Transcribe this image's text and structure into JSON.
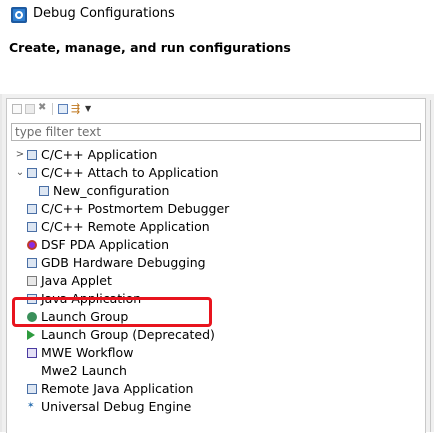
{
  "window": {
    "title": "Debug Configurations"
  },
  "header": {
    "title": "Create, manage, and run configurations"
  },
  "filter": {
    "placeholder": "type filter text"
  },
  "toolbar": {
    "icons": [
      "new-configuration-icon",
      "duplicate-icon",
      "delete-icon",
      "collapse-all-icon",
      "filter-icon",
      "dropdown-arrow-icon"
    ]
  },
  "tree": {
    "items": [
      {
        "label": "C/C++ Application",
        "expand": ">",
        "icon": "c-app-icon"
      },
      {
        "label": "C/C++ Attach to Application",
        "expand": "⌄",
        "icon": "c-attach-icon"
      },
      {
        "label": "New_configuration",
        "icon": "c-config-icon"
      },
      {
        "label": "C/C++ Postmortem Debugger",
        "icon": "c-postmortem-icon"
      },
      {
        "label": "C/C++ Remote Application",
        "icon": "c-remote-icon"
      },
      {
        "label": "DSF PDA Application",
        "icon": "dsf-pda-icon"
      },
      {
        "label": "GDB Hardware Debugging",
        "icon": "gdb-hardware-icon"
      },
      {
        "label": "Java Applet",
        "icon": "java-applet-icon"
      },
      {
        "label": "Java Application",
        "icon": "java-app-icon"
      },
      {
        "label": "Launch Group",
        "icon": "launch-group-icon"
      },
      {
        "label": "Launch Group (Deprecated)",
        "icon": "launch-group-deprecated-icon"
      },
      {
        "label": "MWE Workflow",
        "icon": "mwe-workflow-icon"
      },
      {
        "label": "Mwe2 Launch",
        "icon": ""
      },
      {
        "label": "Remote Java Application",
        "icon": "remote-java-icon"
      },
      {
        "label": "Universal Debug Engine",
        "icon": "ude-icon"
      }
    ]
  },
  "colors": {
    "highlight": "#e8141e",
    "panel_border": "#c8c8c8",
    "background": "#f0f0f0"
  }
}
